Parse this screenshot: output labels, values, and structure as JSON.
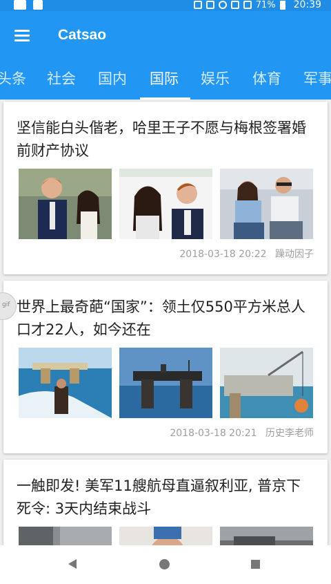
{
  "status": {
    "battery": "71%",
    "time": "20:39"
  },
  "app": {
    "title": "Catsao"
  },
  "tabs": [
    "头条",
    "社会",
    "国内",
    "国际",
    "娱乐",
    "体育",
    "军事"
  ],
  "active_tab": "国际",
  "articles": [
    {
      "title": "坚信能白头偕老，哈里王子不愿与梅根签署婚前财产协议",
      "time": "2018-03-18 20:22",
      "source": "躁动因子",
      "thumbs": [
        "royal-couple-photo",
        "royal-couple-photo",
        "couple-at-event-photo"
      ]
    },
    {
      "title": "世界上最奇葩“国家”：领土仅550平方米总人口才22人，如今还在",
      "time": "2018-03-18 20:21",
      "source": "历史李老师",
      "thumbs": [
        "sea-fort-boat-photo",
        "sea-fort-photo",
        "sea-platform-crane-photo"
      ]
    },
    {
      "title": "一触即发! 美军11艘航母直逼叙利亚, 普京下死令: 3天内结束战斗",
      "thumbs": [
        "street-photo",
        "portrait-photo",
        "military-photo"
      ]
    }
  ],
  "gif_badge": "gif",
  "colors": {
    "primary": "#2196f3",
    "status_bar": "#1f8de6",
    "meta_text": "#9e9e9e"
  }
}
